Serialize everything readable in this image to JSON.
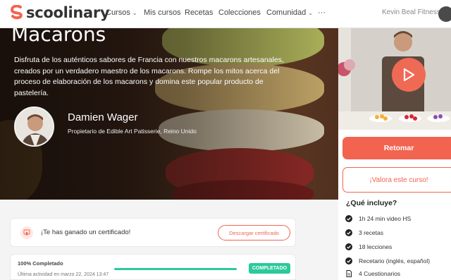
{
  "brand": {
    "name": "scoolinary",
    "accent": "#f26450",
    "success": "#2cc99b"
  },
  "nav": {
    "items": [
      {
        "label": "Cursos",
        "has_dropdown": true
      },
      {
        "label": "Mis cursos",
        "has_dropdown": false
      },
      {
        "label": "Recetas",
        "has_dropdown": false
      },
      {
        "label": "Colecciones",
        "has_dropdown": false
      },
      {
        "label": "Comunidad",
        "has_dropdown": true
      }
    ],
    "more_label": "···",
    "user_name": "Kevin Beal Fitness"
  },
  "hero": {
    "title": "Macarons",
    "description": "Disfruta de los auténticos sabores de Francia con nuestros macarons artesanales, creados por un verdadero maestro de los macarons. Rompe los mitos acerca del proceso de elaboración de los macarons y domina este popular producto de pastelería.",
    "instructor_name": "Damien Wager",
    "instructor_role": "Propietario de Edible Art Patisserie, Reino Unido"
  },
  "sidebar": {
    "primary_button": "Retomar",
    "rate_button": "¡Valora este curso!",
    "includes_title": "¿Qué incluye?",
    "includes": [
      {
        "icon": "check-circle-icon",
        "label": "1h 24 min video HS"
      },
      {
        "icon": "check-circle-icon",
        "label": "3 recetas"
      },
      {
        "icon": "check-circle-icon",
        "label": "18 lecciones"
      },
      {
        "icon": "check-circle-icon",
        "label": "Recetario (inglés, español)"
      },
      {
        "icon": "document-icon",
        "label": "4 Cuestionarios"
      }
    ]
  },
  "certificate": {
    "icon": "certificate-icon",
    "text": "¡Te has ganado un certificado!",
    "button": "Descargar certificado"
  },
  "progress": {
    "title": "100% Completado",
    "last_activity": "Última actividad en marzo 22, 2024 13:47",
    "percent": 100,
    "badge": "COMPLETADO"
  }
}
